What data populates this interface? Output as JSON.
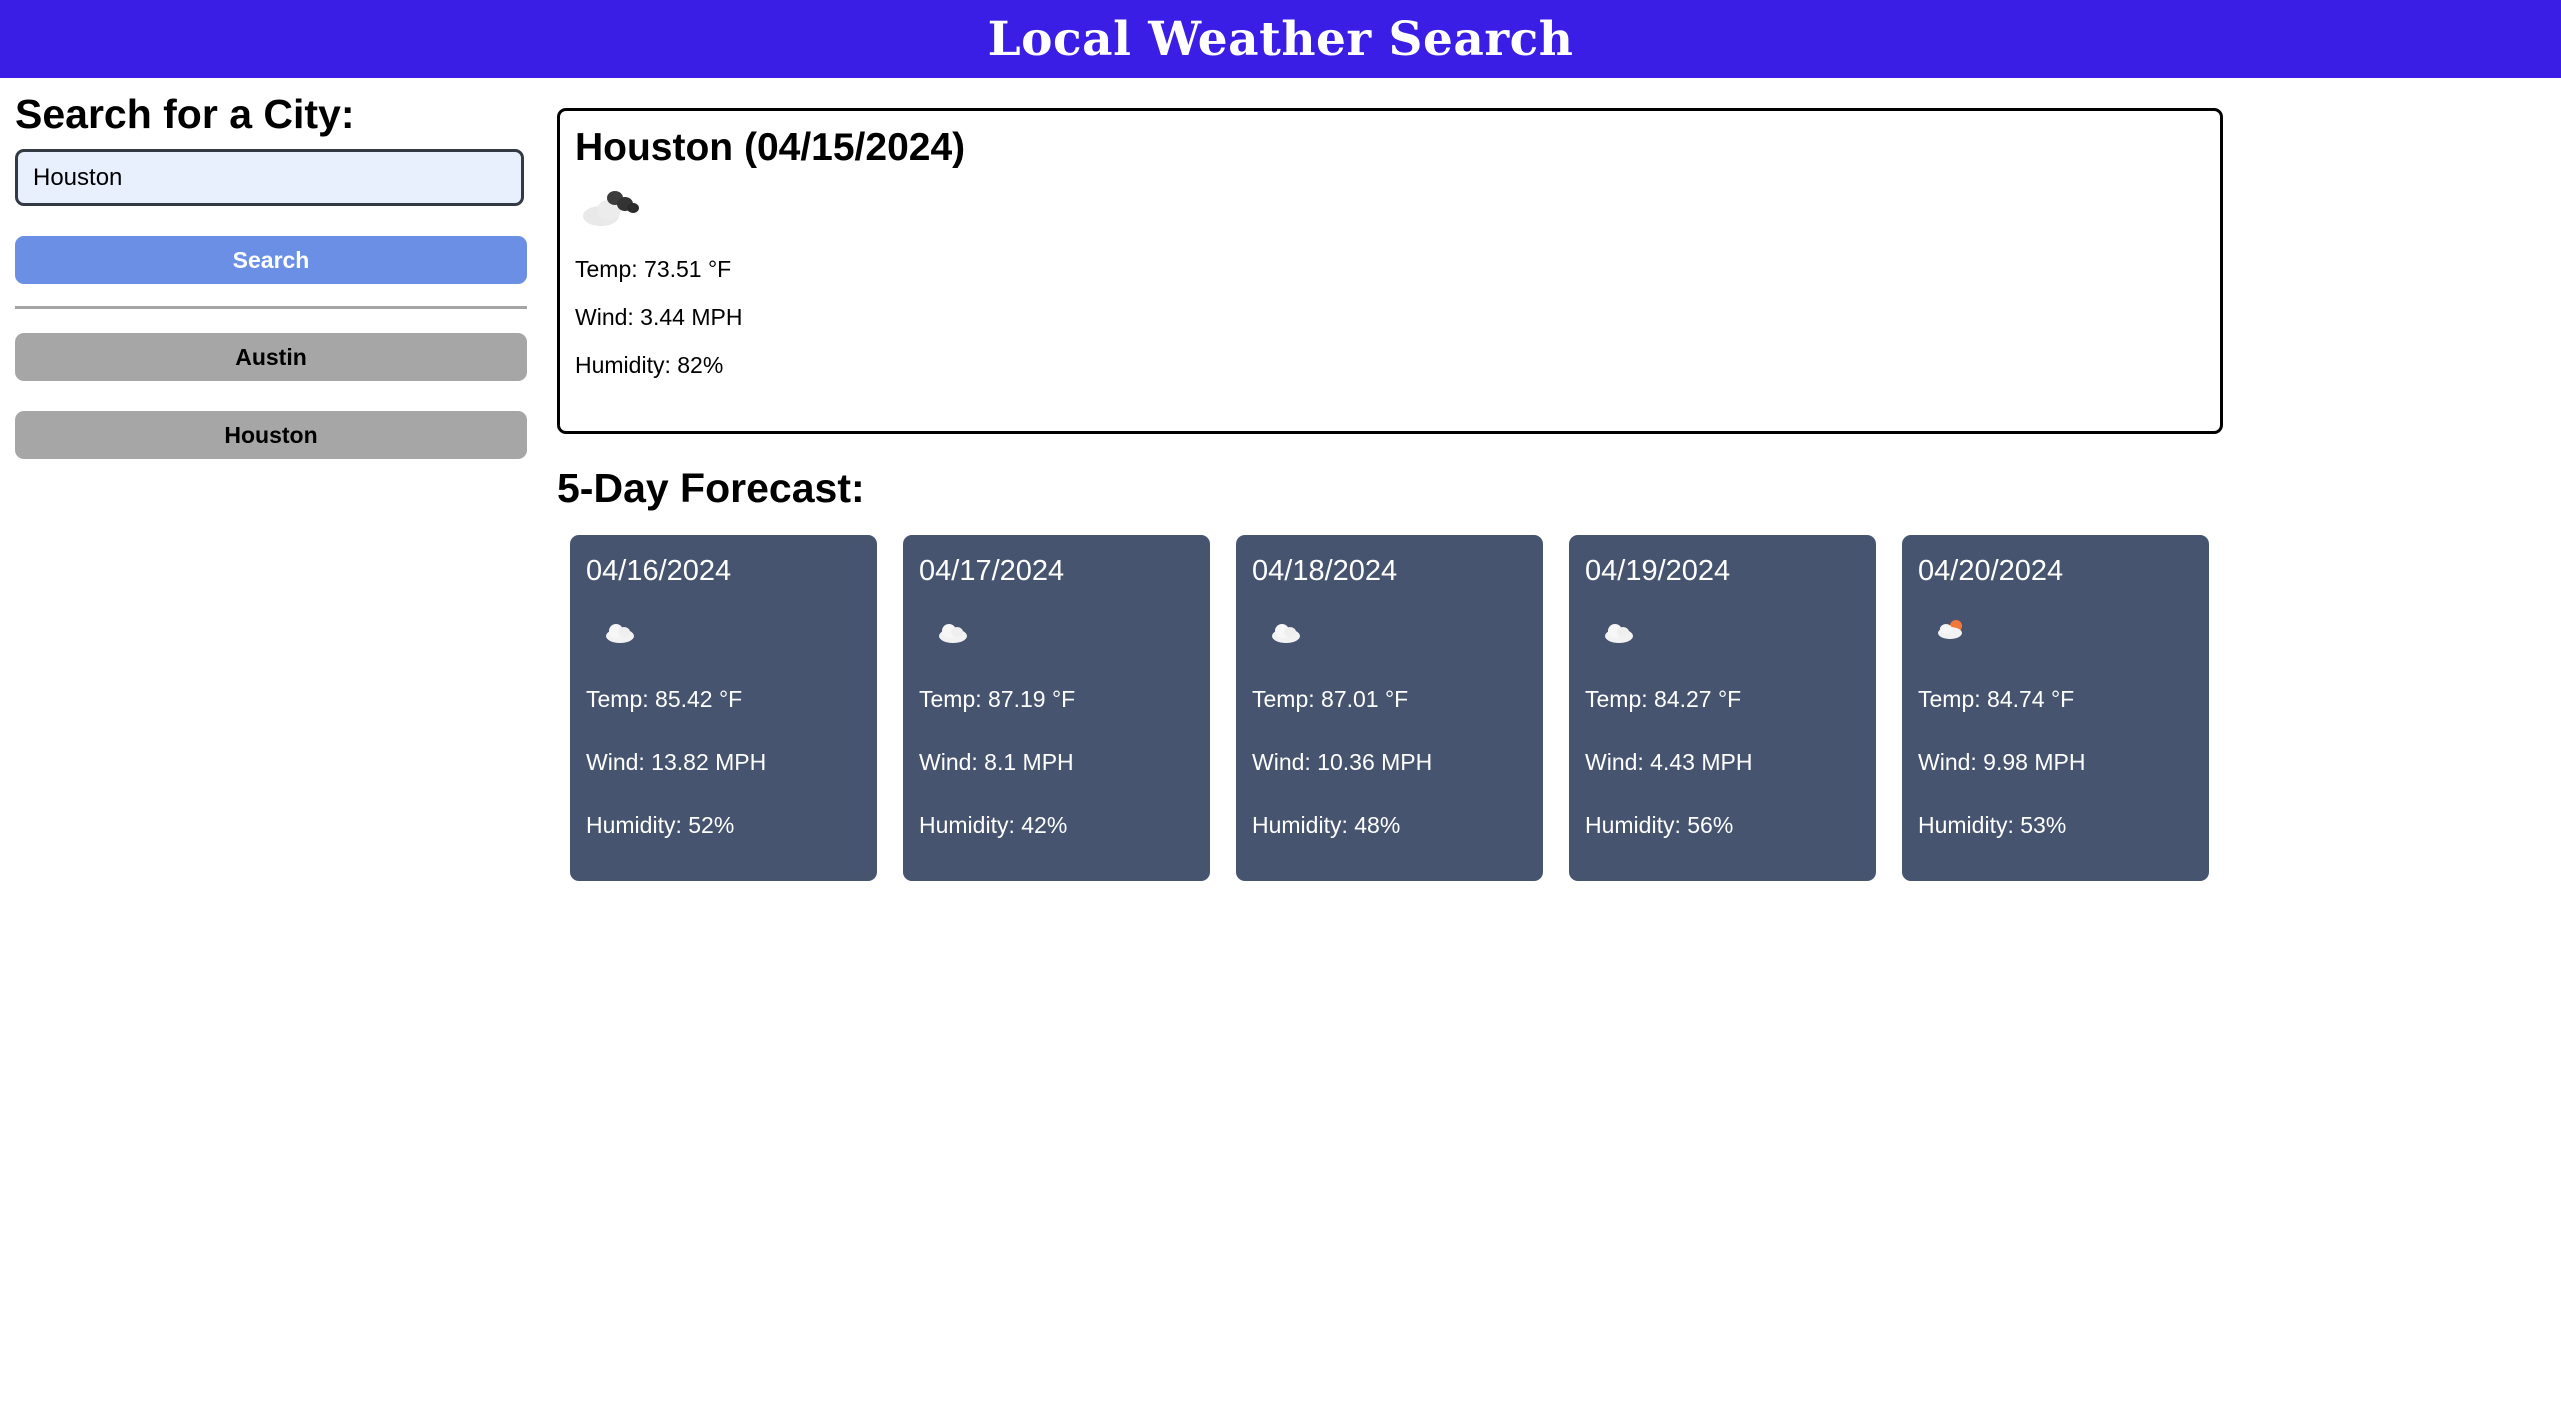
{
  "header": {
    "title": "Local Weather Search"
  },
  "sidebar": {
    "heading": "Search for a City:",
    "search_value": "Houston",
    "search_button": "Search",
    "history": [
      "Austin",
      "Houston"
    ]
  },
  "current": {
    "title": "Houston (04/15/2024)",
    "icon": "broken-clouds-icon",
    "temp": "Temp: 73.51 °F",
    "wind": "Wind: 3.44 MPH",
    "humidity": "Humidity: 82%"
  },
  "forecast": {
    "heading": "5-Day Forecast:",
    "days": [
      {
        "date": "04/16/2024",
        "icon": "cloud-icon",
        "temp": "Temp: 85.42 °F",
        "wind": "Wind: 13.82 MPH",
        "humidity": "Humidity: 52%"
      },
      {
        "date": "04/17/2024",
        "icon": "cloud-icon",
        "temp": "Temp: 87.19 °F",
        "wind": "Wind: 8.1 MPH",
        "humidity": "Humidity: 42%"
      },
      {
        "date": "04/18/2024",
        "icon": "cloud-icon",
        "temp": "Temp: 87.01 °F",
        "wind": "Wind: 10.36 MPH",
        "humidity": "Humidity: 48%"
      },
      {
        "date": "04/19/2024",
        "icon": "cloud-icon",
        "temp": "Temp: 84.27 °F",
        "wind": "Wind: 4.43 MPH",
        "humidity": "Humidity: 56%"
      },
      {
        "date": "04/20/2024",
        "icon": "partly-cloudy-icon",
        "temp": "Temp: 84.74 °F",
        "wind": "Wind: 9.98 MPH",
        "humidity": "Humidity: 53%"
      }
    ]
  },
  "colors": {
    "header_bg": "#3a1ee5",
    "search_button": "#6a8fe4",
    "history_button": "#a6a6a6",
    "card_bg": "#46546f"
  }
}
